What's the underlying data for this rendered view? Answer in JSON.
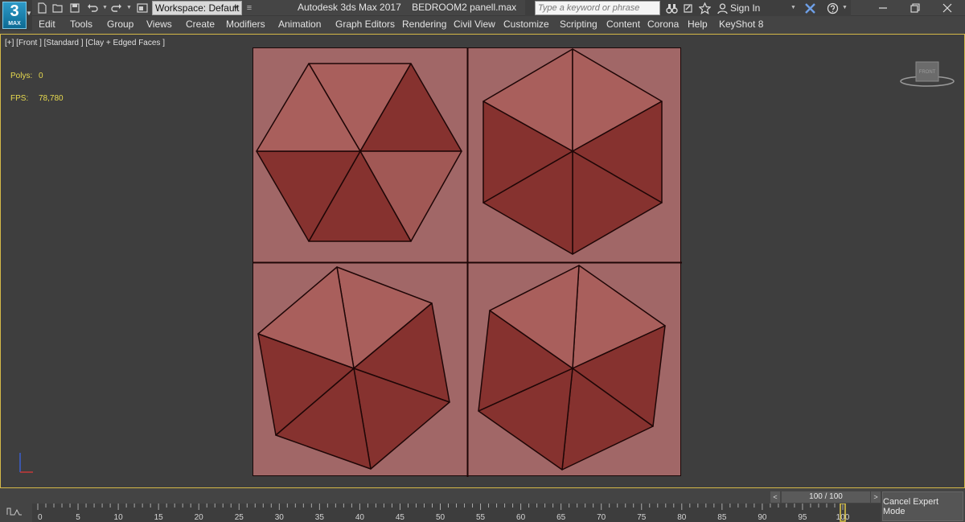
{
  "app": {
    "logo_text": "3",
    "logo_sub": "MAX",
    "title": "Autodesk 3ds Max 2017    BEDROOM2 panell.max",
    "workspace": "Workspace: Default",
    "search_placeholder": "Type a keyword or phrase",
    "signin": "Sign In"
  },
  "menu": [
    "Edit",
    "Tools",
    "Group",
    "Views",
    "Create",
    "Modifiers",
    "Animation",
    "Graph Editors",
    "Rendering",
    "Civil View",
    "Customize",
    "Scripting",
    "Content",
    "Corona",
    "Help",
    "KeyShot 8"
  ],
  "viewport": {
    "label": "[+] [Front ] [Standard ] [Clay + Edged Faces ]",
    "polys_label": "Polys:",
    "polys_value": "0",
    "fps_label": "FPS:",
    "fps_value": "78,780",
    "viewcube_label": "FRONT"
  },
  "timeline": {
    "frame_counter": "100 / 100",
    "current_frame": 100,
    "ticks": [
      "0",
      "5",
      "10",
      "15",
      "20",
      "25",
      "30",
      "35",
      "40",
      "45",
      "50",
      "55",
      "60",
      "65",
      "70",
      "75",
      "80",
      "85",
      "90",
      "95",
      "100"
    ],
    "cancel_button": "Cancel Expert Mode"
  },
  "colors": {
    "plane": "#a16767",
    "face_light": "#a95f5c",
    "face_dark": "#86322f",
    "edge": "#1e0606",
    "viewport_border": "#d4b848",
    "stat_text": "#e7da4f"
  }
}
